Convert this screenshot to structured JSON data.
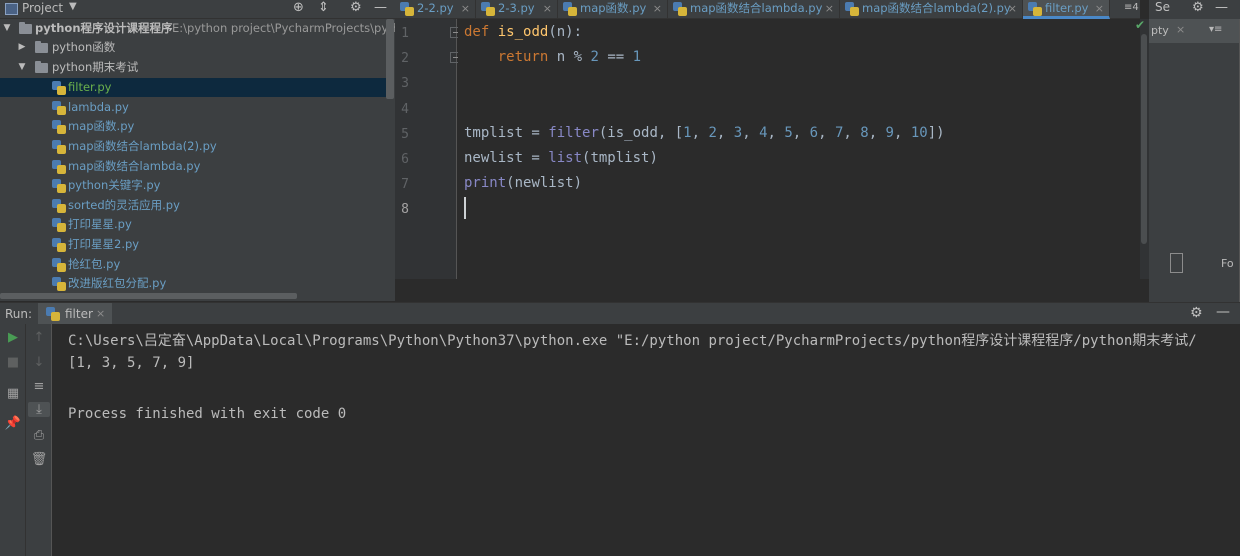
{
  "project_panel": {
    "title": "Project",
    "root_name": "python程序设计课程程序",
    "root_path": "E:\\python project\\PycharmProjects\\pytho",
    "folders": [
      "python函数",
      "python期末考试"
    ],
    "files": [
      "filter.py",
      "lambda.py",
      "map函数.py",
      "map函数结合lambda(2).py",
      "map函数结合lambda.py",
      "python关键字.py",
      "sorted的灵活应用.py",
      "打印星星.py",
      "打印星星2.py",
      "抢红包.py",
      "改进版红包分配.py"
    ],
    "selected_file": "filter.py"
  },
  "tabs": [
    {
      "label": "2-2.py",
      "active": false
    },
    {
      "label": "2-3.py",
      "active": false
    },
    {
      "label": "map函数.py",
      "active": false
    },
    {
      "label": "map函数结合lambda.py",
      "active": false
    },
    {
      "label": "map函数结合lambda(2).py",
      "active": false
    },
    {
      "label": "filter.py",
      "active": true
    }
  ],
  "tab_overflow": "≡4",
  "right_panel": {
    "tab_label": "pty",
    "header_label": "Se",
    "bottom_label": "Fo"
  },
  "editor": {
    "line_numbers": [
      "1",
      "2",
      "3",
      "4",
      "5",
      "6",
      "7",
      "8"
    ],
    "lines": [
      "def is_odd(n):",
      "    return n % 2 == 1",
      "",
      "",
      "tmplist = filter(is_odd, [1, 2, 3, 4, 5, 6, 7, 8, 9, 10])",
      "newlist = list(tmplist)",
      "print(newlist)",
      ""
    ],
    "current_line": 8
  },
  "run_panel": {
    "label": "Run:",
    "tab_label": "filter",
    "console": [
      "C:\\Users\\吕定奋\\AppData\\Local\\Programs\\Python\\Python37\\python.exe \"E:/python project/PycharmProjects/python程序设计课程程序/python期末考试/",
      "[1, 3, 5, 7, 9]",
      "",
      "Process finished with exit code 0"
    ]
  }
}
